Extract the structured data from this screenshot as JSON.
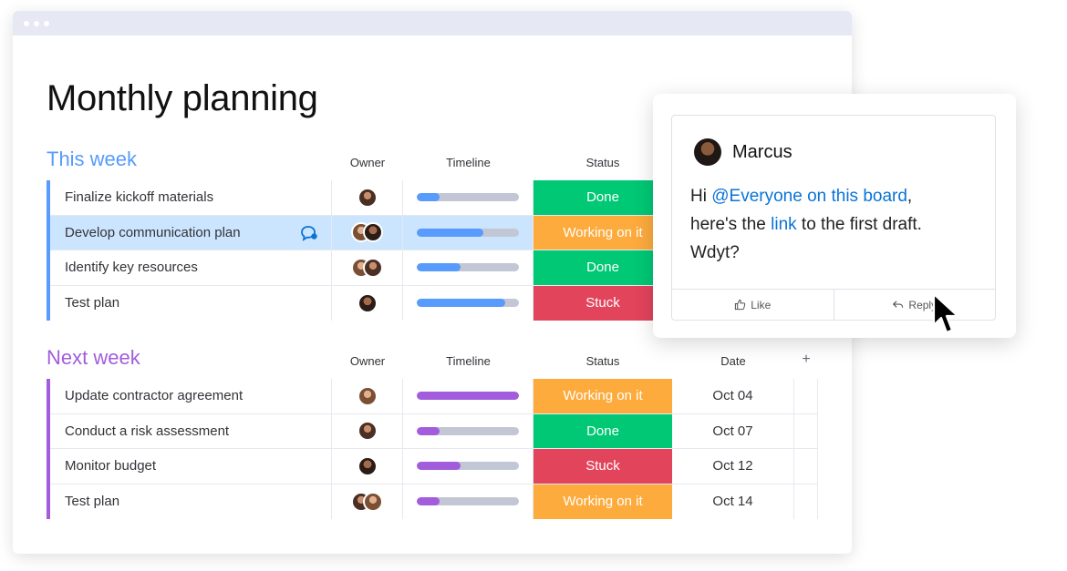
{
  "page_title": "Monthly planning",
  "colors": {
    "done": "#00c875",
    "working": "#fdab3d",
    "stuck": "#e2445c",
    "blue": "#579bfc",
    "purple": "#a25ddc",
    "track": "#c3c6d4"
  },
  "groups": [
    {
      "title": "This week",
      "color": "#579bfc",
      "headers": {
        "owner": "Owner",
        "timeline": "Timeline",
        "status": "Status"
      },
      "rows": [
        {
          "name": "Finalize kickoff materials",
          "owners": 1,
          "timeline_progress": 0.22,
          "status": "Done",
          "status_color": "#00c875"
        },
        {
          "name": "Develop communication plan",
          "owners": 2,
          "timeline_progress": 0.65,
          "status": "Working on it",
          "status_color": "#fdab3d",
          "highlighted": true,
          "icon": "chat-bubble-icon"
        },
        {
          "name": "Identify key resources",
          "owners": 2,
          "timeline_progress": 0.43,
          "status": "Done",
          "status_color": "#00c875"
        },
        {
          "name": "Test plan",
          "owners": 1,
          "timeline_progress": 0.87,
          "status": "Stuck",
          "status_color": "#e2445c"
        }
      ]
    },
    {
      "title": "Next week",
      "color": "#a25ddc",
      "headers": {
        "owner": "Owner",
        "timeline": "Timeline",
        "status": "Status",
        "date": "Date",
        "add": "+"
      },
      "rows": [
        {
          "name": "Update contractor agreement",
          "owners": 1,
          "timeline_progress": 1.0,
          "status": "Working on it",
          "status_color": "#fdab3d",
          "date": "Oct 04"
        },
        {
          "name": "Conduct a risk assessment",
          "owners": 1,
          "timeline_progress": 0.22,
          "status": "Done",
          "status_color": "#00c875",
          "date": "Oct 07"
        },
        {
          "name": "Monitor budget",
          "owners": 1,
          "timeline_progress": 0.43,
          "status": "Stuck",
          "status_color": "#e2445c",
          "date": "Oct 12"
        },
        {
          "name": "Test plan",
          "owners": 2,
          "timeline_progress": 0.22,
          "status": "Working on it",
          "status_color": "#fdab3d",
          "date": "Oct 14"
        }
      ]
    }
  ],
  "comment": {
    "author": "Marcus",
    "greeting": "Hi ",
    "mention": "@Everyone on this board",
    "after_mention": ",",
    "line2_pre": "here's the ",
    "link": "link",
    "line2_post": " to the first draft.",
    "line3": "Wdyt?",
    "like_label": "Like",
    "reply_label": "Reply"
  }
}
